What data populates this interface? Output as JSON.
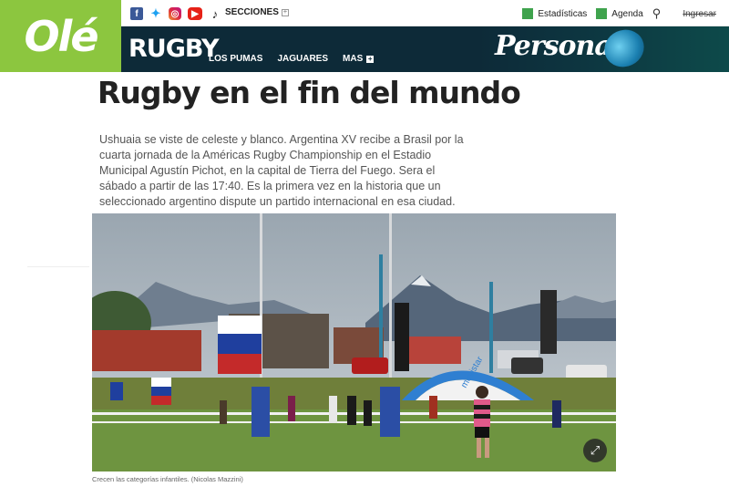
{
  "logo": "Olé",
  "topbar": {
    "secciones": "SECCIONES",
    "estadisticas": "Estadísticas",
    "agenda": "Agenda",
    "ingresar": "Ingresar"
  },
  "section": {
    "title": "RUGBY",
    "nav": [
      "LOS PUMAS",
      "JAGUARES",
      "MAS"
    ]
  },
  "sponsor": "Personal",
  "article": {
    "headline": "Rugby en el fin del mundo",
    "summary": "Ushuaia se viste de celeste y blanco. Argentina XV recibe a Brasil por la cuarta jornada de la Américas Rugby Championship en el Estadio Municipal Agustín Pichot, en la capital de Tierra del Fuego. Sera el sábado a partir de las 17:40. Es la primera vez en la historia que un seleccionado argentino dispute un partido internacional en esa ciudad.",
    "caption": "Crecen las categorías infantiles. (Nicolas Mazzini)",
    "photo_banner_text": "movistar"
  },
  "colors": {
    "brand_green": "#8cc63f",
    "section_bg": "#0d2a38"
  }
}
